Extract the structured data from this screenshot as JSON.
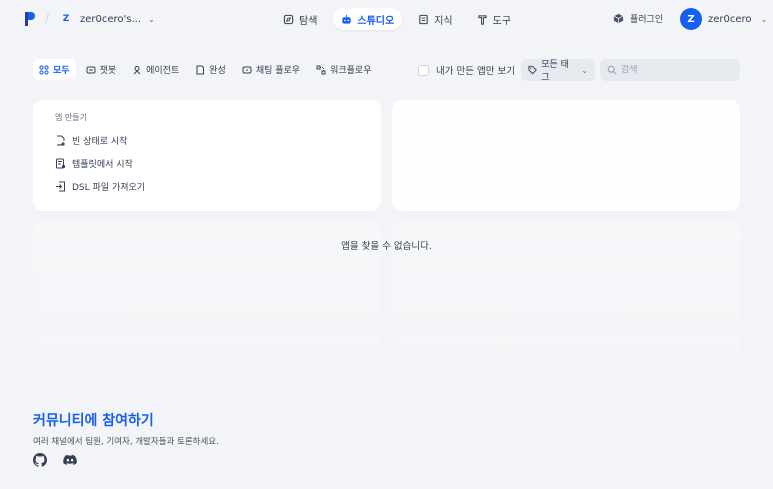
{
  "header": {
    "workspace_badge": "Z",
    "workspace_name": "zer0cero's...",
    "nav": [
      {
        "label": "탐색",
        "icon": "compass-icon"
      },
      {
        "label": "스튜디오",
        "icon": "robot-icon",
        "active": true
      },
      {
        "label": "지식",
        "icon": "book-icon"
      },
      {
        "label": "도구",
        "icon": "hammer-icon"
      }
    ],
    "plugins_label": "플러그인",
    "user_initial": "Z",
    "user_name": "zer0cero"
  },
  "filters": {
    "tabs": [
      {
        "label": "모두",
        "icon": "grid-icon",
        "active": true
      },
      {
        "label": "챗봇",
        "icon": "chat-icon"
      },
      {
        "label": "에이전트",
        "icon": "agent-icon"
      },
      {
        "label": "완성",
        "icon": "document-icon"
      },
      {
        "label": "채팅 플로우",
        "icon": "chatflow-icon"
      },
      {
        "label": "워크플로우",
        "icon": "workflow-icon"
      }
    ],
    "mine_label": "내가 만든 앱만 보기",
    "tag_label": "모든 태그",
    "search_placeholder": "검색"
  },
  "create": {
    "title": "앱 만들기",
    "items": [
      {
        "label": "빈 상태로 시작",
        "icon": "file-plus-icon"
      },
      {
        "label": "템플릿에서 시작",
        "icon": "template-icon"
      },
      {
        "label": "DSL 파일 가져오기",
        "icon": "import-icon"
      }
    ]
  },
  "empty_message": "앱을 찾을 수 없습니다.",
  "community": {
    "title": "커뮤니티에 참여하기",
    "subtitle": "여러 채널에서 팀원, 기여자, 개발자들과 토론하세요."
  },
  "colors": {
    "accent": "#155eef",
    "background": "#f2f4f7"
  }
}
